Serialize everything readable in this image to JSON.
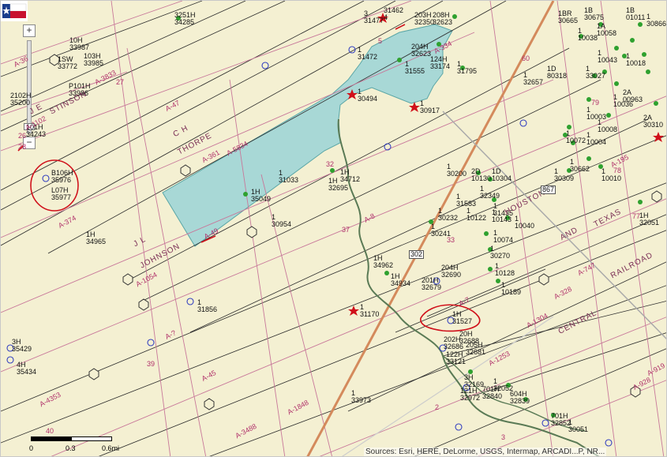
{
  "map": {
    "water_color": "#a8d8d6",
    "tract_line_color": "#c8789a",
    "well_green": "#2fa12f",
    "annotation_red": "#d0101a"
  },
  "wells": [
    {
      "id": "w01",
      "label": "3251H",
      "label2": "34285"
    },
    {
      "id": "w02",
      "label": "10H",
      "label2": "33987"
    },
    {
      "id": "w03",
      "label": "1SW",
      "label2": "33772"
    },
    {
      "id": "w04",
      "label": "103H",
      "label2": "33985"
    },
    {
      "id": "w05",
      "label": "P101H",
      "label2": "33986"
    },
    {
      "id": "w06",
      "label": "2102H",
      "label2": "35200"
    },
    {
      "id": "w07",
      "label": "101H",
      "label2": "34243"
    },
    {
      "id": "w08",
      "label": "B106H",
      "label2": "35976"
    },
    {
      "id": "w09",
      "label": "L07H",
      "label2": "35977"
    },
    {
      "id": "w10",
      "label": "1H",
      "label2": "34965"
    },
    {
      "id": "w11",
      "label": "3H",
      "label2": "35429"
    },
    {
      "id": "w12",
      "label": "4H",
      "label2": "35434"
    },
    {
      "id": "w13",
      "label": "1",
      "label2": "31856"
    },
    {
      "id": "w14",
      "label": "1",
      "label2": "31033"
    },
    {
      "id": "w15",
      "label": "1H",
      "label2": "35049"
    },
    {
      "id": "w16",
      "label": "1",
      "label2": "30954"
    },
    {
      "id": "w17",
      "label": "3",
      "label2": "31477"
    },
    {
      "id": "w18",
      "label": "1",
      "label2": "31472"
    },
    {
      "id": "w19",
      "label": "1",
      "label2": "30494"
    },
    {
      "id": "w20",
      "label": "1",
      "label2": "30917"
    },
    {
      "id": "w21",
      "label": "1H",
      "label2": "34712"
    },
    {
      "id": "w22",
      "label": "1H",
      "label2": "32695"
    },
    {
      "id": "w23",
      "label": "1H",
      "label2": "34962"
    },
    {
      "id": "w24",
      "label": "1H",
      "label2": "34934"
    },
    {
      "id": "w25",
      "label": "1",
      "label2": "31170"
    },
    {
      "id": "w26",
      "label": "1",
      "label2": "33973"
    },
    {
      "id": "w27",
      "label": "31462",
      "label2": "4"
    },
    {
      "id": "w28",
      "label": "203H",
      "label2": "32350"
    },
    {
      "id": "w29",
      "label": "208H",
      "label2": "32623"
    },
    {
      "id": "w30",
      "label": "204H",
      "label2": "32623"
    },
    {
      "id": "w31",
      "label": "1",
      "label2": "31555"
    },
    {
      "id": "w32",
      "label": "124H",
      "label2": "33174"
    },
    {
      "id": "w33",
      "label": "1",
      "label2": "31795"
    },
    {
      "id": "w34",
      "label": "1",
      "label2": "32657"
    },
    {
      "id": "w35",
      "label": "1D",
      "label2": "80318"
    },
    {
      "id": "w36",
      "label": "1",
      "label2": "30200"
    },
    {
      "id": "w37",
      "label": "2D",
      "label2": "10130"
    },
    {
      "id": "w38",
      "label": "1D",
      "label2": "10304"
    },
    {
      "id": "w39",
      "label": "1",
      "label2": "32349"
    },
    {
      "id": "w40",
      "label": "1",
      "label2": "31583"
    },
    {
      "id": "w41",
      "label": "1",
      "label2": "10122"
    },
    {
      "id": "w42",
      "label": "1",
      "label2": "31435"
    },
    {
      "id": "w43",
      "label": "1",
      "label2": "10143"
    },
    {
      "id": "w44",
      "label": "1",
      "label2": "10040"
    },
    {
      "id": "w45",
      "label": "1",
      "label2": "30232"
    },
    {
      "id": "w46",
      "label": "1",
      "label2": "30241"
    },
    {
      "id": "w47",
      "label": "1",
      "label2": "10074"
    },
    {
      "id": "w48",
      "label": "1",
      "label2": "30270"
    },
    {
      "id": "w49",
      "label": "1",
      "label2": "10128"
    },
    {
      "id": "w50",
      "label": "1",
      "label2": "10189"
    },
    {
      "id": "w51",
      "label": "204H",
      "label2": "32690"
    },
    {
      "id": "w52",
      "label": "201H",
      "label2": "32679"
    },
    {
      "id": "w53",
      "label": "1H",
      "label2": "31527"
    },
    {
      "id": "w54",
      "label": "20H",
      "label2": "32688"
    },
    {
      "id": "w55",
      "label": "202H",
      "label2": "32686"
    },
    {
      "id": "w56",
      "label": "205H",
      "label2": "32681"
    },
    {
      "id": "w57",
      "label": "122H",
      "label2": "33121"
    },
    {
      "id": "w58",
      "label": "1",
      "label2": "32052"
    },
    {
      "id": "w59",
      "label": "3H",
      "label2": "32169"
    },
    {
      "id": "w60",
      "label": "121H",
      "label2": "32972"
    },
    {
      "id": "w61",
      "label": "701H",
      "label2": "32840"
    },
    {
      "id": "w62",
      "label": "604H",
      "label2": "32839"
    },
    {
      "id": "w63",
      "label": "701H",
      "label2": "32852"
    },
    {
      "id": "w64",
      "label": "1",
      "label2": "30051"
    },
    {
      "id": "w65",
      "label": "1",
      "label2": "30662"
    },
    {
      "id": "w66",
      "label": "1",
      "label2": "30309"
    },
    {
      "id": "w67",
      "label": "1",
      "label2": "10010"
    },
    {
      "id": "w68",
      "label": "1",
      "label2": "10003"
    },
    {
      "id": "w69",
      "label": "1",
      "label2": "10008"
    },
    {
      "id": "w70",
      "label": "1",
      "label2": "10072"
    },
    {
      "id": "w71",
      "label": "1",
      "label2": "10004"
    },
    {
      "id": "w72",
      "label": "1",
      "label2": "10036"
    },
    {
      "id": "w73",
      "label": "1",
      "label2": "10043"
    },
    {
      "id": "w74",
      "label": "1",
      "label2": "10018"
    },
    {
      "id": "w75",
      "label": "1",
      "label2": "33027"
    },
    {
      "id": "w76",
      "label": "1",
      "label2": "10038"
    },
    {
      "id": "w77",
      "label": "1A",
      "label2": "10058"
    },
    {
      "id": "w78",
      "label": "1BR",
      "label2": "30665"
    },
    {
      "id": "w79",
      "label": "1B",
      "label2": "30675"
    },
    {
      "id": "w80",
      "label": "1B",
      "label2": "01011"
    },
    {
      "id": "w81",
      "label": "2A",
      "label2": "30310"
    },
    {
      "id": "w82",
      "label": "1H",
      "label2": "32051"
    },
    {
      "id": "w83",
      "label": "2A",
      "label2": "00963"
    },
    {
      "id": "w84",
      "label": "1",
      "label2": "30866"
    }
  ],
  "tracts": [
    {
      "id": "t01",
      "text": "A-1102"
    },
    {
      "id": "t02",
      "text": "A-374"
    },
    {
      "id": "t03",
      "text": "A-1054"
    },
    {
      "id": "t04",
      "text": "A-4353"
    },
    {
      "id": "t05",
      "text": "A-361"
    },
    {
      "id": "t06",
      "text": "A-5834"
    },
    {
      "id": "t07",
      "text": "A-47"
    },
    {
      "id": "t08",
      "text": "A-49"
    },
    {
      "id": "t09",
      "text": "A-8"
    },
    {
      "id": "t10",
      "text": "A-?"
    },
    {
      "id": "t11",
      "text": "A-45"
    },
    {
      "id": "t12",
      "text": "A-1848"
    },
    {
      "id": "t13",
      "text": "A-3488"
    },
    {
      "id": "t14",
      "text": "A-334"
    },
    {
      "id": "t15",
      "text": "A-7"
    },
    {
      "id": "t16",
      "text": "A-1304"
    },
    {
      "id": "t17",
      "text": "A-747"
    },
    {
      "id": "t18",
      "text": "A-328"
    },
    {
      "id": "t19",
      "text": "A-195"
    },
    {
      "id": "t20",
      "text": "A-928"
    },
    {
      "id": "t21",
      "text": "A-919"
    },
    {
      "id": "t22",
      "text": "A-1253"
    },
    {
      "id": "t23",
      "text": "A-3833"
    },
    {
      "id": "t24",
      "text": "A-36"
    },
    {
      "id": "t25",
      "text": "27"
    },
    {
      "id": "t26",
      "text": "26"
    },
    {
      "id": "t27",
      "text": "28"
    },
    {
      "id": "t28",
      "text": "32"
    },
    {
      "id": "t29",
      "text": "37"
    },
    {
      "id": "t30",
      "text": "39"
    },
    {
      "id": "t31",
      "text": "40"
    },
    {
      "id": "t32",
      "text": "60"
    },
    {
      "id": "t33",
      "text": "79"
    },
    {
      "id": "t34",
      "text": "78"
    },
    {
      "id": "t35",
      "text": "77"
    },
    {
      "id": "t36",
      "text": "33"
    },
    {
      "id": "t37",
      "text": "2"
    },
    {
      "id": "t38",
      "text": "3"
    },
    {
      "id": "t39",
      "text": "5"
    }
  ],
  "surveys": [
    {
      "id": "s1",
      "text": "C H"
    },
    {
      "id": "s2",
      "text": "THORPE"
    },
    {
      "id": "s3",
      "text": "J L"
    },
    {
      "id": "s4",
      "text": "JOHNSON"
    },
    {
      "id": "s5",
      "text": "HOUSTON"
    },
    {
      "id": "s6",
      "text": "AND"
    },
    {
      "id": "s7",
      "text": "TEXAS"
    },
    {
      "id": "s8",
      "text": "CENTRAL"
    },
    {
      "id": "s9",
      "text": "RAILROAD"
    },
    {
      "id": "s10",
      "text": "STINSON"
    },
    {
      "id": "s11",
      "text": "J E"
    }
  ],
  "roads": [
    {
      "id": "r1",
      "text": "867"
    },
    {
      "id": "r2",
      "text": "302"
    }
  ],
  "scale": {
    "labels": [
      "0",
      "0.3",
      "0.6mi"
    ]
  },
  "attribution": "Sources: Esri, HERE, DeLorme, USGS, Intermap, ARCADI...P, NR...",
  "zoom": {
    "plus": "+",
    "minus": "−"
  }
}
